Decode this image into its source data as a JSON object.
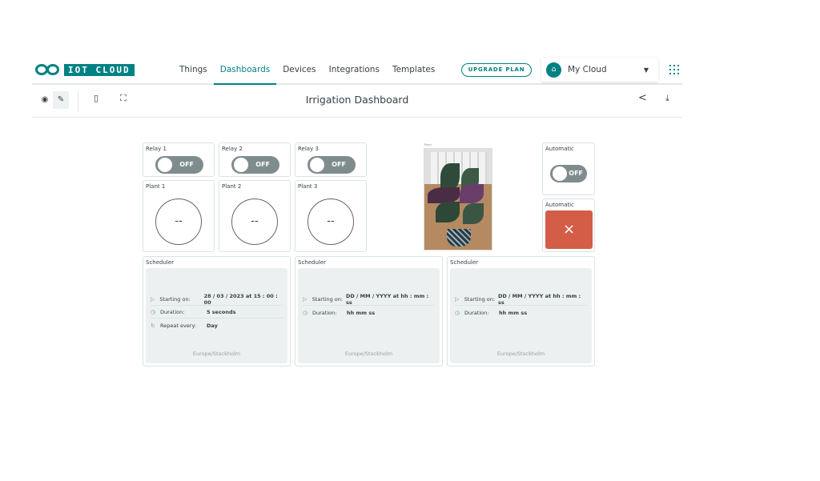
{
  "header": {
    "logo_text": "IOT CLOUD",
    "nav": [
      "Things",
      "Dashboards",
      "Devices",
      "Integrations",
      "Templates"
    ],
    "active_nav": "Dashboards",
    "upgrade_label": "UPGRADE PLAN",
    "space_label": "My Cloud",
    "space_icon": "home-icon"
  },
  "toolbar": {
    "title": "Irrigation Dashboard",
    "view_icon": "eye-icon",
    "edit_icon": "pencil-icon",
    "mobile_icon": "mobile-icon",
    "fullscreen_icon": "fullscreen-icon",
    "share_icon": "share-icon",
    "download_icon": "download-icon"
  },
  "relays": [
    {
      "title": "Relay 1",
      "state": "OFF"
    },
    {
      "title": "Relay 2",
      "state": "OFF"
    },
    {
      "title": "Relay 3",
      "state": "OFF"
    }
  ],
  "plants": [
    {
      "title": "Plant 1",
      "value": "--"
    },
    {
      "title": "Plant 2",
      "value": "--"
    },
    {
      "title": "Plant 3",
      "value": "--"
    }
  ],
  "image_widget": {
    "title": "Plant"
  },
  "automatic_switch": {
    "title": "Automatic",
    "state": "OFF"
  },
  "automatic_status": {
    "title": "Automatic",
    "symbol": "×"
  },
  "schedulers": [
    {
      "title": "Scheduler",
      "starting_label": "Starting on:",
      "starting_value": "28 / 03 / 2023 at 15 : 00 : 00",
      "duration_label": "Duration:",
      "duration_value": "5 seconds",
      "repeat_label": "Repeat every:",
      "repeat_value": "Day",
      "timezone": "Europe/Stockholm"
    },
    {
      "title": "Scheduler",
      "starting_label": "Starting on:",
      "starting_value": "DD / MM / YYYY at hh : mm : ss",
      "duration_label": "Duration:",
      "duration_value": "hh mm ss",
      "timezone": "Europe/Stockholm"
    },
    {
      "title": "Scheduler",
      "starting_label": "Starting on:",
      "starting_value": "DD / MM / YYYY at hh : mm : ss",
      "duration_label": "Duration:",
      "duration_value": "hh mm ss",
      "timezone": "Europe/Stockholm"
    }
  ]
}
